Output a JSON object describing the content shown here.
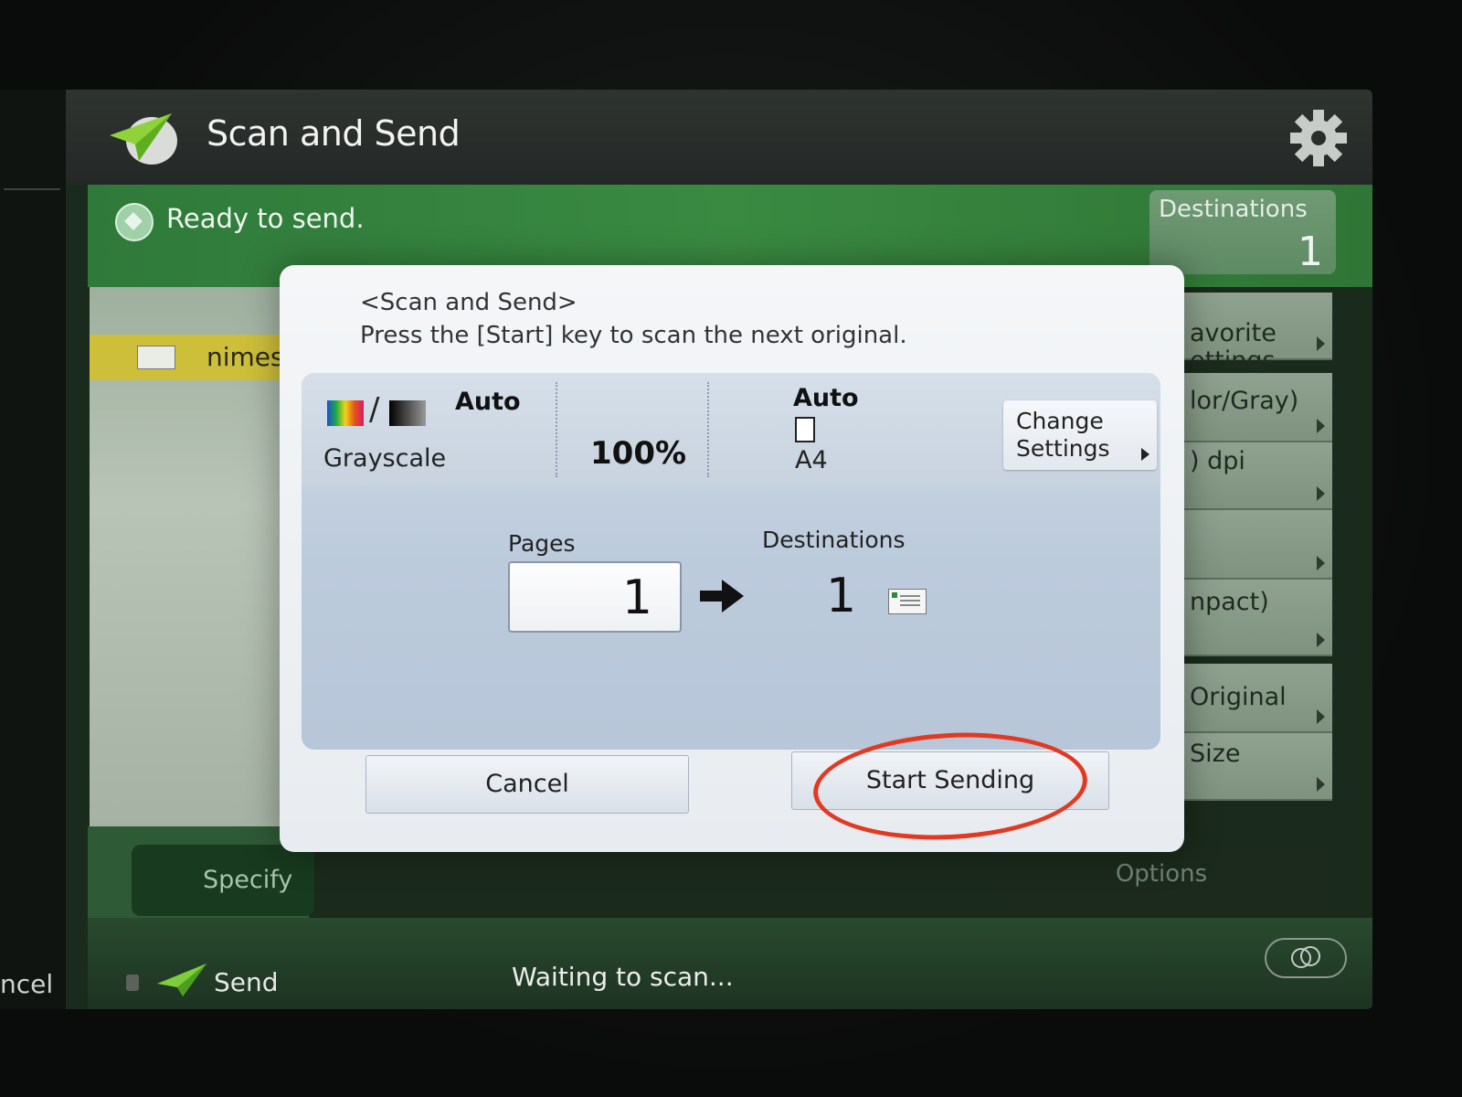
{
  "app": {
    "title": "Scan and Send",
    "status": "Ready to send."
  },
  "destinations_panel": {
    "label": "Destinations",
    "count": "1"
  },
  "address_list": {
    "row_text": "nimesh",
    "specify_label": "Specify"
  },
  "right_menu": {
    "items": [
      {
        "label": "avorite\nettings"
      },
      {
        "label": "lor/Gray)"
      },
      {
        "label": ") dpi"
      },
      {
        "label": ""
      },
      {
        "label": "npact)"
      },
      {
        "label": "Original"
      },
      {
        "label": "Size"
      }
    ],
    "options_label": "Options"
  },
  "dialog": {
    "title": "<Scan and Send>",
    "message": "Press the [Start] key to scan the next original.",
    "color_mode_value": "Auto",
    "color_mode_label": "Grayscale",
    "zoom": "100%",
    "paper_value": "Auto",
    "paper_size": "A4",
    "change_settings_label": "Change\nSettings",
    "pages_label": "Pages",
    "pages_value": "1",
    "destinations_label": "Destinations",
    "destinations_value": "1",
    "cancel_label": "Cancel",
    "start_label": "Start Sending"
  },
  "footer": {
    "cancel_fragment": "ncel",
    "send_label": "Send",
    "status": "Waiting to scan..."
  },
  "colors": {
    "accent_green": "#3a8a42",
    "highlight_ring": "#e23a22",
    "dialog_bg": "#f4f6f8"
  },
  "icons": {
    "app": "paper-plane-icon",
    "settings": "gear-icon",
    "status": "ready-diamond-icon",
    "arrow": "right-arrow-icon",
    "destination": "address-card-icon"
  }
}
